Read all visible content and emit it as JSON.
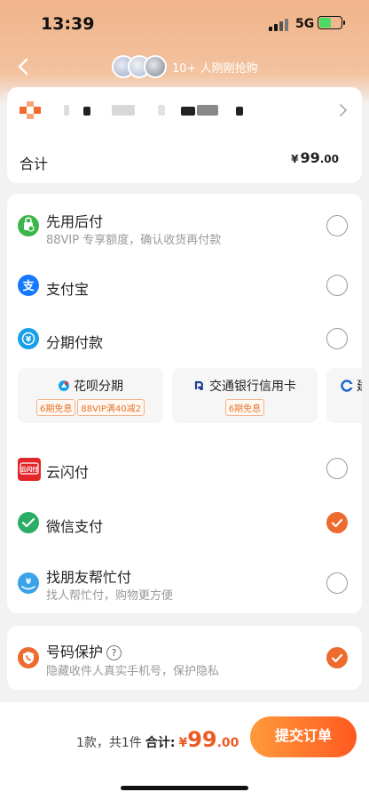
{
  "status_bar": {
    "time": "13:39",
    "network": "5G"
  },
  "nav": {
    "social_proof": "10+ 人刚刚抢购"
  },
  "order": {
    "total_label": "合计",
    "currency": "¥",
    "amount_int": "99",
    "amount_dec": ".00"
  },
  "payment_methods": [
    {
      "title": "先用后付",
      "subtitle": "88VIP 专享额度，确认收货再付款",
      "icon": "pay-later-icon",
      "color": "#3cb54a",
      "checked": false
    },
    {
      "title": "支付宝",
      "icon": "alipay-icon",
      "color": "#1677ff",
      "checked": false
    },
    {
      "title": "分期付款",
      "icon": "installment-icon",
      "color": "#1aa0e8",
      "checked": false
    },
    {
      "title": "云闪付",
      "icon": "unionpay-quickpass-icon",
      "color": "#e3262a",
      "checked": false
    },
    {
      "title": "微信支付",
      "icon": "wechat-pay-icon",
      "color": "#2aae67",
      "checked": true
    },
    {
      "title": "找朋友帮忙付",
      "subtitle": "找人帮忙付，购物更方便",
      "icon": "friend-pay-icon",
      "color": "#3aa3e8",
      "checked": false
    }
  ],
  "installment_options": [
    {
      "name": "花呗分期",
      "tags": [
        "6期免息",
        "88VIP满40减2"
      ],
      "icon": "huabei-icon"
    },
    {
      "name": "交通银行信用卡",
      "tags": [
        "6期免息"
      ],
      "icon": "bocom-icon"
    },
    {
      "name": "建",
      "tags": [],
      "icon": "ccb-icon"
    }
  ],
  "privacy": {
    "title": "号码保护",
    "help": "?",
    "subtitle": "隐藏收件人真实手机号，保护隐私",
    "checked": true
  },
  "bottom": {
    "count_text": "1款，共1件",
    "total_word": "合计:",
    "currency": "¥",
    "amount_int": "99",
    "amount_dec": ".00",
    "submit_label": "提交订单"
  },
  "colors": {
    "accent": "#ee6b2f",
    "header": "#f0b48a"
  }
}
